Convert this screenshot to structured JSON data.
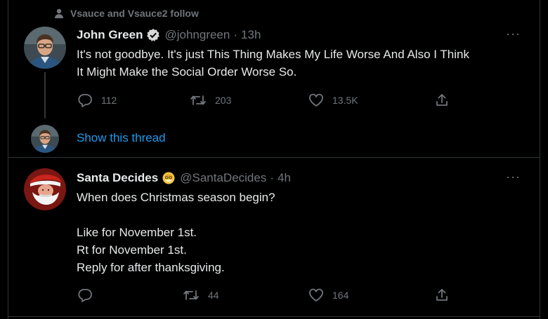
{
  "social_context": "Vsauce and Vsauce2 follow",
  "tweet1": {
    "name": "John Green",
    "handle": "@johngreen",
    "time": "13h",
    "text": "It's not goodbye. It's just This Thing Makes My Life Worse And Also I Think\nIt Might Make the Social Order Worse So.",
    "replies": "112",
    "retweets": "203",
    "likes": "13.5K"
  },
  "show_thread": "Show this thread",
  "tweet2": {
    "name": "Santa Decides",
    "handle": "@SantaDecides",
    "time": "4h",
    "text": "When does Christmas season begin?\n\nLike for November 1st.\nRt for November 1st.\nReply for after thanksgiving.",
    "replies": "",
    "retweets": "44",
    "likes": "164"
  },
  "colors": {
    "background": "#000000",
    "text": "#e7e9ea",
    "secondary": "#71767b",
    "link": "#1d9bf0",
    "divider": "#2f3336",
    "verified_badge": "#d9d9d9",
    "bot_badge": "#f5c542"
  },
  "icons": {
    "social_context": "person-icon",
    "verified": "verified-badge-icon",
    "bot_badge": "santa-face-badge-icon",
    "reply": "reply-bubble-icon",
    "retweet": "retweet-icon",
    "like": "heart-icon",
    "share": "share-icon",
    "more": "more-dots-icon"
  }
}
